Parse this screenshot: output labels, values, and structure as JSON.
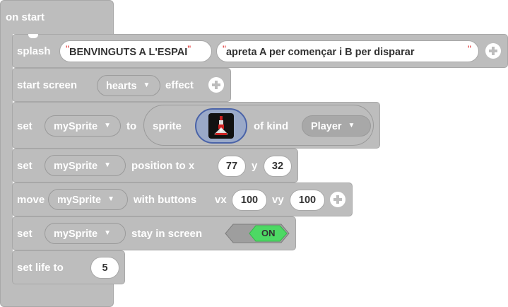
{
  "on_start": {
    "label": "on start"
  },
  "splash": {
    "label": "splash",
    "title": "BENVINGUTS A L'ESPAI",
    "subtitle": "apreta A per començar i B per disparar"
  },
  "start_screen": {
    "label": "start screen",
    "effect_value": "hearts",
    "suffix": "effect"
  },
  "set_sprite": {
    "label": "set",
    "variable": "mySprite",
    "to": "to",
    "sprite_label": "sprite",
    "of_kind": "of kind",
    "kind_value": "Player"
  },
  "set_position": {
    "label": "set",
    "variable": "mySprite",
    "text": "position to x",
    "x_value": "77",
    "y_label": "y",
    "y_value": "32"
  },
  "move": {
    "label": "move",
    "variable": "mySprite",
    "text": "with buttons",
    "vx_label": "vx",
    "vx_value": "100",
    "vy_label": "vy",
    "vy_value": "100"
  },
  "stay": {
    "label": "set",
    "variable": "mySprite",
    "text": "stay in screen",
    "toggle_value": "ON",
    "toggle_color": "#4dd964"
  },
  "life": {
    "label": "set life to",
    "value": "5"
  },
  "colors": {
    "block": "#bdbdbd",
    "quote": "#e03030",
    "sprite_bg": "#9aa9c8"
  },
  "icons": {
    "add": "plus-circle-icon",
    "dropdown": "caret-down-icon",
    "sprite": "spaceship-sprite"
  }
}
